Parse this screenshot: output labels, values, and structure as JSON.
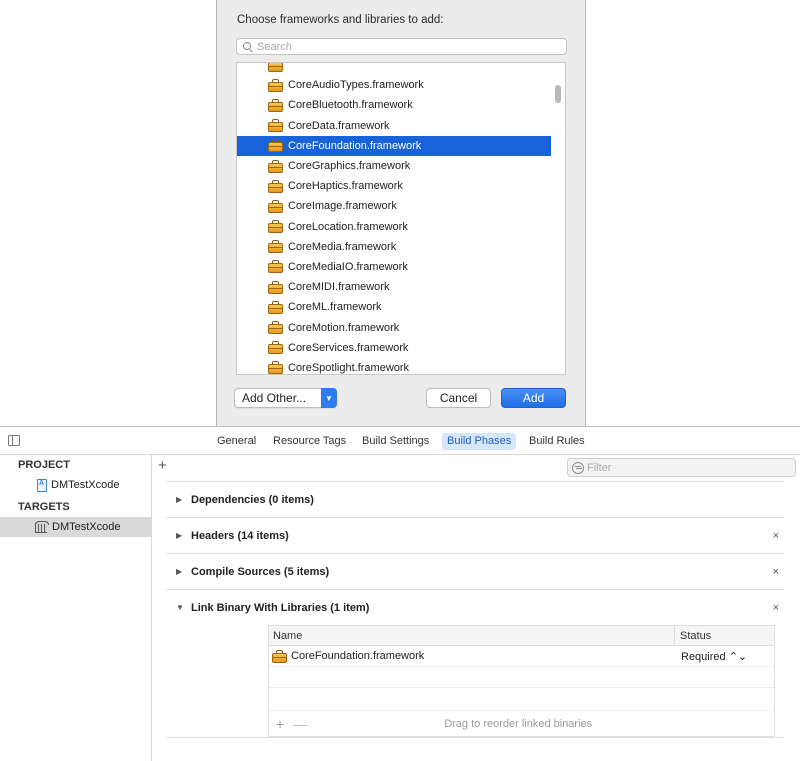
{
  "sheet": {
    "title": "Choose frameworks and libraries to add:",
    "search_placeholder": "Search",
    "frameworks": [
      "",
      "CoreAudioTypes.framework",
      "CoreBluetooth.framework",
      "CoreData.framework",
      "CoreFoundation.framework",
      "CoreGraphics.framework",
      "CoreHaptics.framework",
      "CoreImage.framework",
      "CoreLocation.framework",
      "CoreMedia.framework",
      "CoreMediaIO.framework",
      "CoreMIDI.framework",
      "CoreML.framework",
      "CoreMotion.framework",
      "CoreServices.framework",
      "CoreSpotlight.framework"
    ],
    "selected": "CoreFoundation.framework",
    "add_other_label": "Add Other...",
    "cancel_label": "Cancel",
    "add_label": "Add",
    "accent": "#1863da"
  },
  "editor": {
    "tabs": [
      "General",
      "Resource Tags",
      "Build Settings",
      "Build Phases",
      "Build Rules"
    ],
    "active_tab": "Build Phases",
    "project_header": "PROJECT",
    "project_item": "DMTestXcode",
    "targets_header": "TARGETS",
    "target_item": "DMTestXcode",
    "add_symbol": "+",
    "filter_placeholder": "Filter",
    "phases": [
      {
        "label": "Dependencies (0 items)",
        "expanded": false,
        "removable": false
      },
      {
        "label": "Headers (14 items)",
        "expanded": false,
        "removable": true
      },
      {
        "label": "Compile Sources (5 items)",
        "expanded": false,
        "removable": true
      },
      {
        "label": "Link Binary With Libraries (1 item)",
        "expanded": true,
        "removable": true
      }
    ],
    "table": {
      "col_name": "Name",
      "col_status": "Status",
      "rows": [
        {
          "name": "CoreFoundation.framework",
          "status": "Required ⌃⌄"
        }
      ],
      "plus": "+",
      "minus": "—",
      "hint": "Drag to reorder linked binaries"
    },
    "close_symbol": "×"
  }
}
